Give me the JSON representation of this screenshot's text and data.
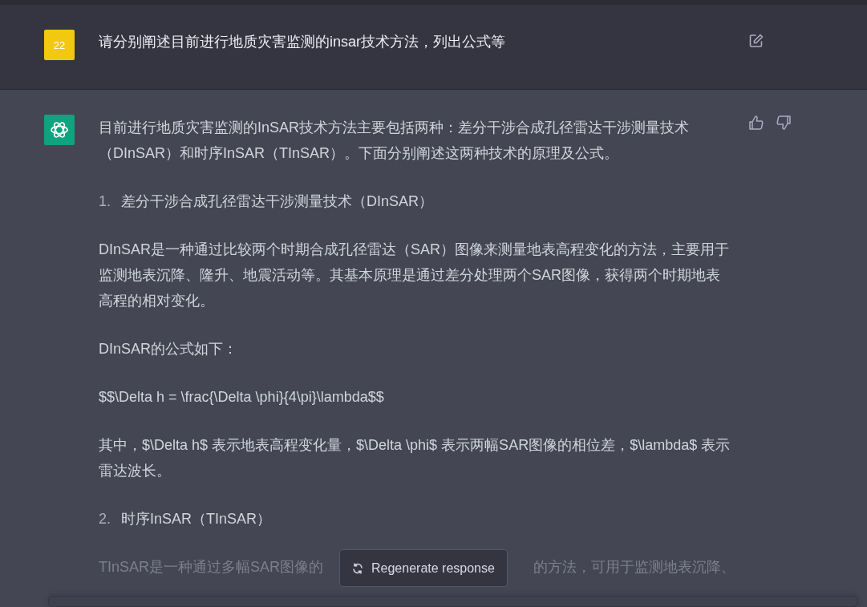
{
  "user_message": {
    "avatar_text": "22",
    "text": "请分别阐述目前进行地质灾害监测的insar技术方法，列出公式等"
  },
  "assistant_message": {
    "blocks": [
      {
        "kind": "paragraph",
        "text": "目前进行地质灾害监测的InSAR技术方法主要包括两种：差分干涉合成孔径雷达干涉测量技术（DInSAR）和时序InSAR（TInSAR）。下面分别阐述这两种技术的原理及公式。"
      },
      {
        "kind": "list_item",
        "number": "1.",
        "text": "差分干涉合成孔径雷达干涉测量技术（DInSAR）"
      },
      {
        "kind": "paragraph",
        "text": "DInSAR是一种通过比较两个时期合成孔径雷达（SAR）图像来测量地表高程变化的方法，主要用于监测地表沉降、隆升、地震活动等。其基本原理是通过差分处理两个SAR图像，获得两个时期地表高程的相对变化。"
      },
      {
        "kind": "paragraph",
        "text": "DInSAR的公式如下："
      },
      {
        "kind": "paragraph",
        "text": "$$\\Delta h = \\frac{\\Delta \\phi}{4\\pi}\\lambda$$"
      },
      {
        "kind": "paragraph",
        "text": "其中，$\\Delta h$ 表示地表高程变化量，$\\Delta \\phi$ 表示两幅SAR图像的相位差，$\\lambda$ 表示雷达波长。"
      },
      {
        "kind": "list_item",
        "number": "2.",
        "text": "时序InSAR（TInSAR）"
      },
      {
        "kind": "faded",
        "parts": [
          "TInSAR是一种通过多幅SAR图像的",
          "的方法，可用于监测地表沉降、"
        ]
      }
    ]
  },
  "regenerate_button": {
    "label": "Regenerate response"
  }
}
